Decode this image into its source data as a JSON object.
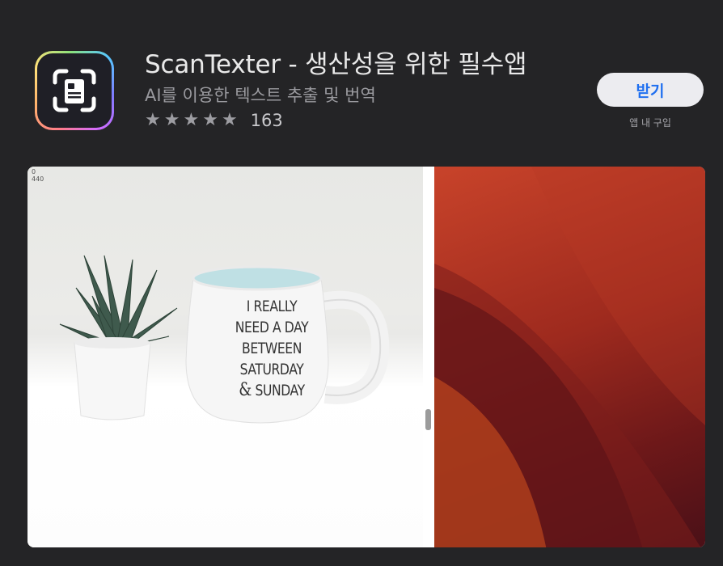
{
  "app": {
    "icon": "document-scan-icon",
    "title": "ScanTexter - 생산성을 위한 필수앱",
    "subtitle": "AI를 이용한 텍스트 추출 및 번역",
    "rating": {
      "stars": 5,
      "star_glyph": "★",
      "count": "163"
    }
  },
  "get_button": {
    "label": "받기",
    "note": "앱 내 구입"
  },
  "screenshot": {
    "coord_readout": "0\n440",
    "mug_lines": [
      "I REALLY",
      "NEED A DAY",
      "BETWEEN",
      "SATURDAY"
    ],
    "mug_last_line": {
      "amp": "&",
      "word": " SUNDAY"
    }
  },
  "colors": {
    "background": "#242426",
    "accent": "#1f6ff0",
    "button_bg": "#ececf0"
  }
}
